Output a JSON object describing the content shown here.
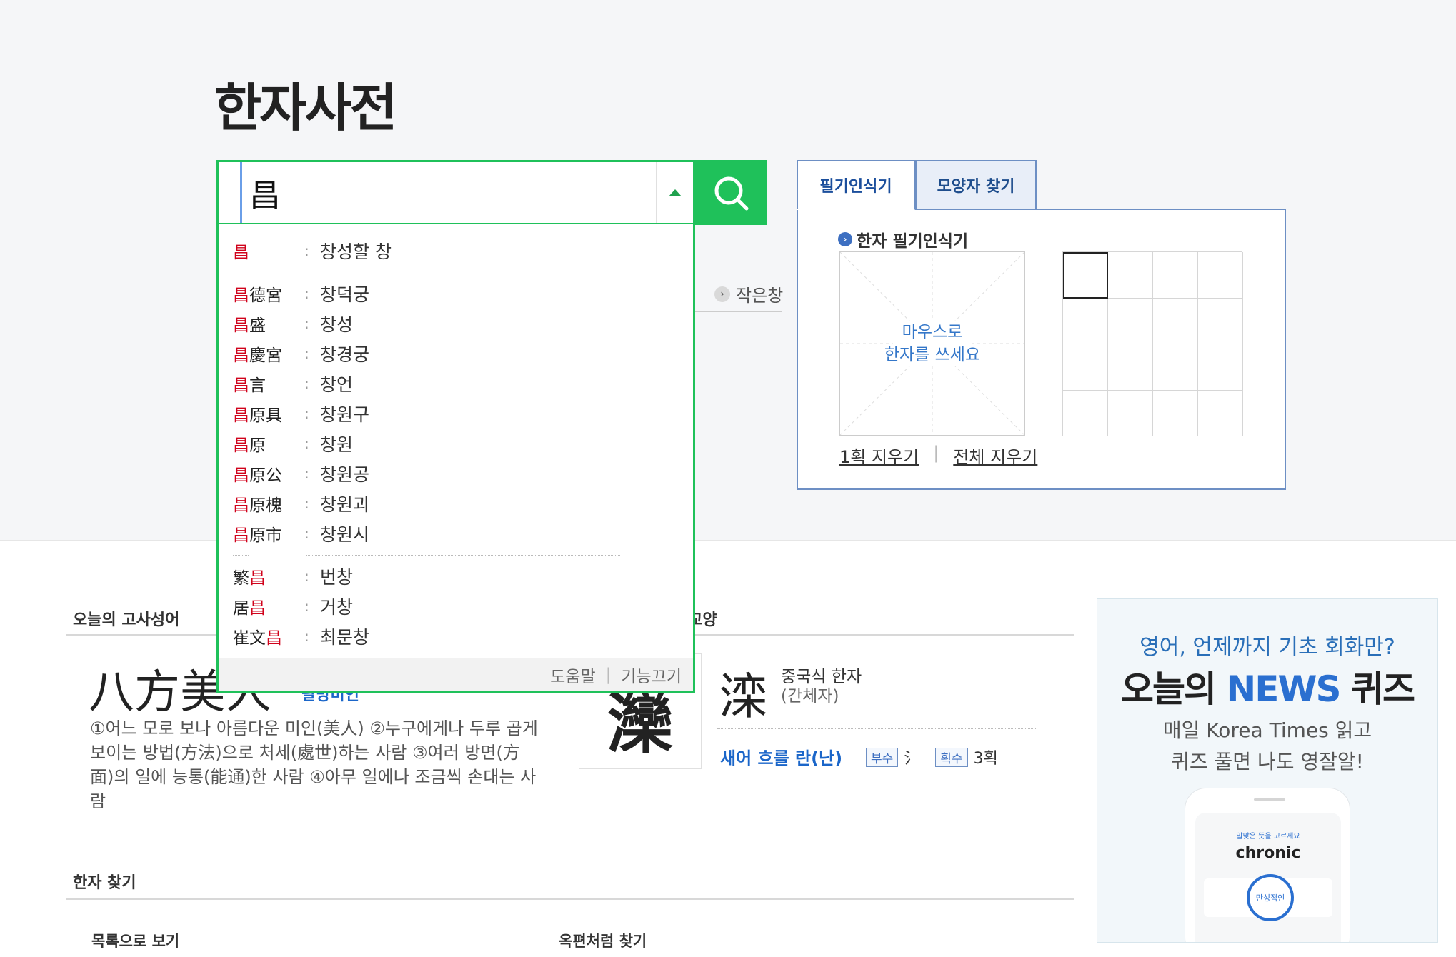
{
  "page": {
    "title": "한자사전"
  },
  "search": {
    "value": "昌",
    "accent_color": "#1fc15a"
  },
  "behind_dropdown": {
    "link_label": "작은창"
  },
  "suggestions": {
    "groups": [
      [
        {
          "prefix": "",
          "highlight": "昌",
          "suffix": "",
          "reading": "창성할 창"
        }
      ],
      [
        {
          "prefix": "",
          "highlight": "昌",
          "suffix": "德宮",
          "reading": "창덕궁"
        },
        {
          "prefix": "",
          "highlight": "昌",
          "suffix": "盛",
          "reading": "창성"
        },
        {
          "prefix": "",
          "highlight": "昌",
          "suffix": "慶宮",
          "reading": "창경궁"
        },
        {
          "prefix": "",
          "highlight": "昌",
          "suffix": "言",
          "reading": "창언"
        },
        {
          "prefix": "",
          "highlight": "昌",
          "suffix": "原具",
          "reading": "창원구"
        },
        {
          "prefix": "",
          "highlight": "昌",
          "suffix": "原",
          "reading": "창원"
        },
        {
          "prefix": "",
          "highlight": "昌",
          "suffix": "原公",
          "reading": "창원공"
        },
        {
          "prefix": "",
          "highlight": "昌",
          "suffix": "原槐",
          "reading": "창원괴"
        },
        {
          "prefix": "",
          "highlight": "昌",
          "suffix": "原市",
          "reading": "창원시"
        }
      ],
      [
        {
          "prefix": "繁",
          "highlight": "昌",
          "suffix": "",
          "reading": "번창"
        },
        {
          "prefix": "居",
          "highlight": "昌",
          "suffix": "",
          "reading": "거창"
        },
        {
          "prefix": "崔文",
          "highlight": "昌",
          "suffix": "",
          "reading": "최문창"
        }
      ]
    ],
    "footer": {
      "help": "도움말",
      "disable": "기능끄기"
    }
  },
  "handwriting": {
    "tabs": [
      "필기인식기",
      "모양자 찾기"
    ],
    "title": "한자 필기인식기",
    "canvas_hint_1": "마우스로",
    "canvas_hint_2": "한자를 쓰세요",
    "clear_one": "1획 지우기",
    "clear_all": "전체 지우기"
  },
  "idiom": {
    "section_title": "오늘의 고사성어",
    "hanja": "八方美人",
    "reading": "팔방미인",
    "description": "①어느 모로 보나 아름다운 미인(美人) ②누구에게나 두루 곱게 보이는 방법(方法)으로 처세(處世)하는 사람 ③여러 방면(方面)의 일에 능통(能通)한 사람 ④아무 일에나 조금씩 손대는 사람"
  },
  "daily_hanja": {
    "section_title_tail": "한자 교양",
    "char": "灤",
    "simplified_char": "滦",
    "simplified_label": "중국식 한자",
    "simplified_sub": "(간체자)",
    "meaning": "새어 흐를 란(난)",
    "radical_badge": "부수",
    "radical": "氵",
    "strokes_badge": "획수",
    "strokes": "3획"
  },
  "find": {
    "section_title": "한자 찾기",
    "list_view": "목록으로 보기",
    "okpyeon": "옥편처럼 찾기"
  },
  "ad": {
    "line1": "영어, 언제까지 기초 회화만?",
    "line2_a": "오늘의 ",
    "line2_news": "NEWS",
    "line2_b": " 퀴즈",
    "line3a": "매일 Korea Times 읽고",
    "line3b": "퀴즈 풀면 나도 영잘알!",
    "phone_small": "알맞은 뜻을 고르세요",
    "phone_word": "chronic",
    "phone_option": "만성적인"
  }
}
